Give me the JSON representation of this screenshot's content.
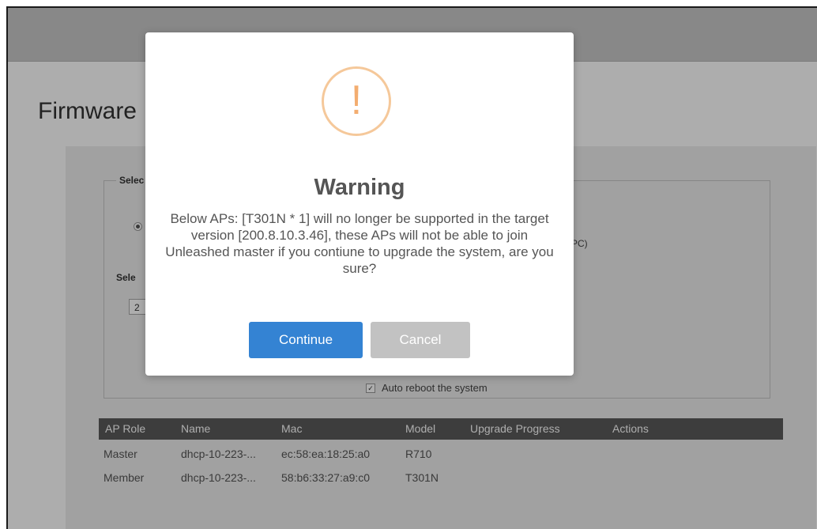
{
  "page": {
    "title": "Firmware"
  },
  "panel": {
    "legend": "Selec",
    "option_tail": "PC)",
    "select_label": "Sele",
    "select_value": "2",
    "auto_reboot_label": "Auto reboot the system"
  },
  "table": {
    "headers": [
      "AP Role",
      "Name",
      "Mac",
      "Model",
      "Upgrade Progress",
      "Actions"
    ],
    "rows": [
      {
        "role": "Master",
        "name": "dhcp-10-223-...",
        "mac": "ec:58:ea:18:25:a0",
        "model": "R710"
      },
      {
        "role": "Member",
        "name": "dhcp-10-223-...",
        "mac": "58:b6:33:27:a9:c0",
        "model": "T301N"
      }
    ]
  },
  "dialog": {
    "icon": "!",
    "title": "Warning",
    "message": "Below APs: [T301N * 1] will no longer be supported in the target version [200.8.10.3.46], these APs will not be able to join Unleashed master if you contiune to upgrade the system, are you sure?",
    "continue_label": "Continue",
    "cancel_label": "Cancel"
  },
  "colors": {
    "primary_button": "#3483d3",
    "cancel_button": "#c2c2c2",
    "warning_icon": "#f3ad70",
    "table_header": "#5a5a5a"
  }
}
